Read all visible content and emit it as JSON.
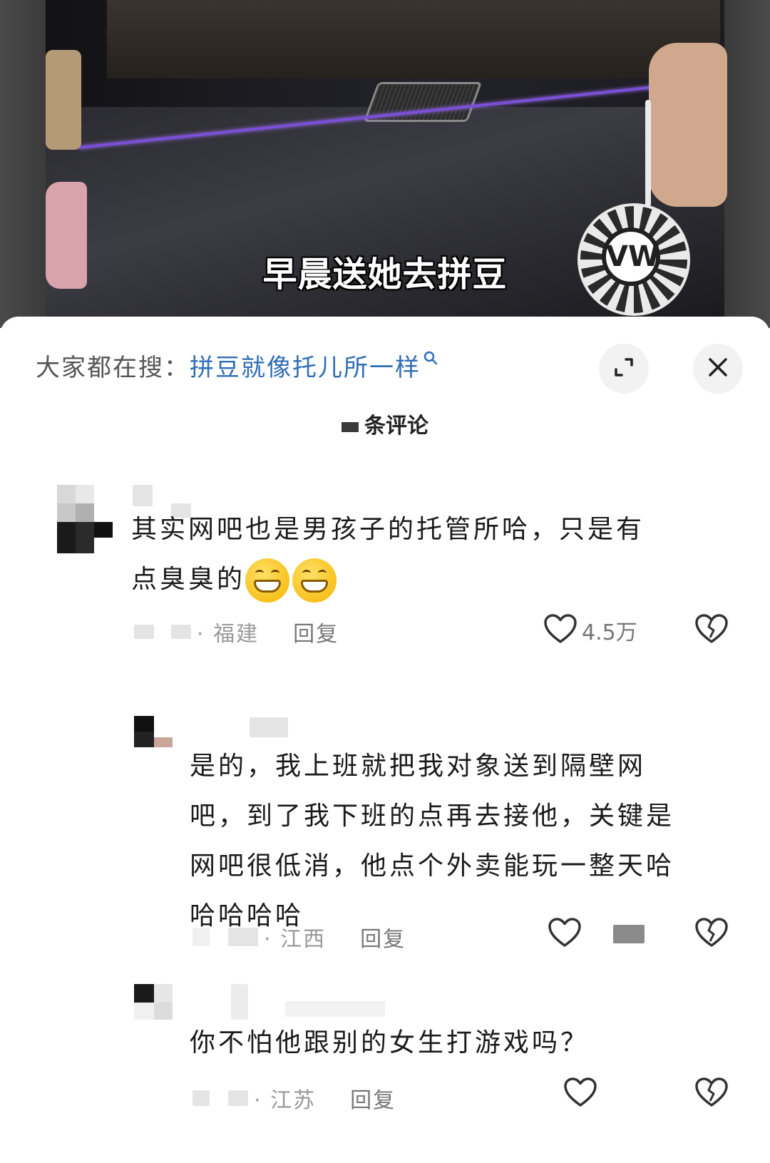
{
  "video": {
    "caption": "早晨送她去拼豆",
    "keychain_logo": "VW"
  },
  "search": {
    "prefix": "大家都在搜：",
    "term": "拼豆就像托儿所一样"
  },
  "header": {
    "count_suffix": "条评论",
    "expand_icon": "expand-icon",
    "close_icon": "close-icon"
  },
  "comments": [
    {
      "text_line1": "其实网吧也是男孩子的托管所哈，只是有",
      "text_line2": "点臭臭的",
      "emoji": "grinning-emoji",
      "location": "· 福建",
      "reply": "回复",
      "likes": "4.5万"
    },
    {
      "text_lines": [
        "是的，我上班就把我对象送到隔壁网",
        "吧，到了我下班的点再去接他，关键是",
        "网吧很低消，他点个外卖能玩一整天哈",
        "哈哈哈哈"
      ],
      "location": "· 江西",
      "reply": "回复"
    },
    {
      "text": "你不怕他跟别的女生打游戏吗？",
      "location": "· 江苏",
      "reply": "回复"
    }
  ],
  "colors": {
    "search_term": "#2f6db5",
    "meta_gray": "#9a9a9a",
    "ambient_light": "#7b4fd6"
  }
}
